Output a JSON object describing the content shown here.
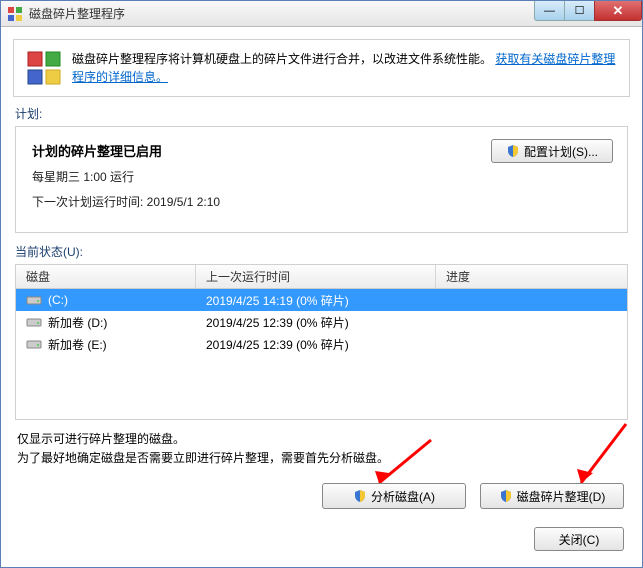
{
  "window": {
    "title": "磁盘碎片整理程序"
  },
  "info": {
    "text": "磁盘碎片整理程序将计算机硬盘上的碎片文件进行合并，以改进文件系统性能。",
    "link": "获取有关磁盘碎片整理程序的详细信息。"
  },
  "schedule": {
    "label": "计划:",
    "title": "计划的碎片整理已启用",
    "line1": "每星期三  1:00 运行",
    "line2": "下一次计划运行时间: 2019/5/1 2:10",
    "configure_btn": "配置计划(S)..."
  },
  "status": {
    "label": "当前状态(U):",
    "headers": {
      "disk": "磁盘",
      "last": "上一次运行时间",
      "progress": "进度"
    },
    "rows": [
      {
        "name": "(C:)",
        "last": "2019/4/25 14:19 (0% 碎片)",
        "progress": "",
        "selected": true
      },
      {
        "name": "新加卷 (D:)",
        "last": "2019/4/25 12:39 (0% 碎片)",
        "progress": "",
        "selected": false
      },
      {
        "name": "新加卷 (E:)",
        "last": "2019/4/25 12:39 (0% 碎片)",
        "progress": "",
        "selected": false
      }
    ]
  },
  "note": {
    "line1": "仅显示可进行碎片整理的磁盘。",
    "line2": "为了最好地确定磁盘是否需要立即进行碎片整理，需要首先分析磁盘。"
  },
  "buttons": {
    "analyze": "分析磁盘(A)",
    "defrag": "磁盘碎片整理(D)",
    "close": "关闭(C)"
  }
}
